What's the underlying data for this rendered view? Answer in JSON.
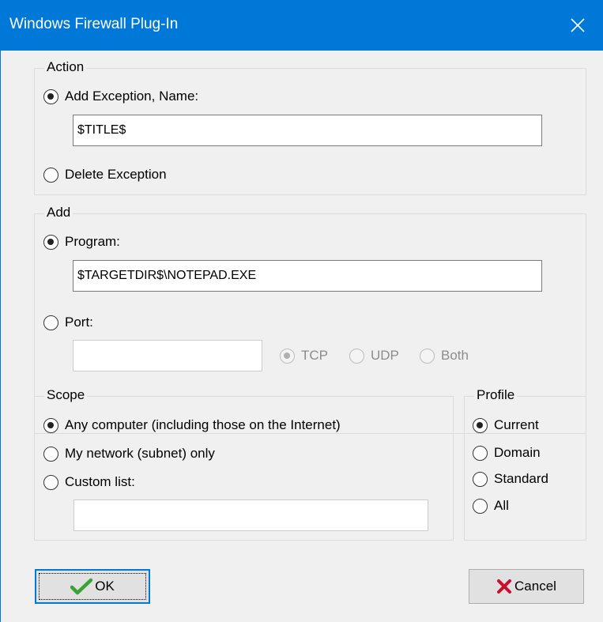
{
  "window": {
    "title": "Windows Firewall Plug-In",
    "close_glyph": "✕"
  },
  "action": {
    "legend": "Action",
    "add_exception_label": "Add Exception, Name:",
    "name_value": "$TITLE$",
    "delete_exception_label": "Delete Exception",
    "selected": "add_exception"
  },
  "add": {
    "legend": "Add",
    "program_label": "Program:",
    "program_value": "$TARGETDIR$\\NOTEPAD.EXE",
    "port_label": "Port:",
    "port_value": "",
    "protocols": [
      "TCP",
      "UDP",
      "Both"
    ],
    "selected_protocol": "TCP",
    "selected": "program"
  },
  "scope": {
    "legend": "Scope",
    "options": [
      "Any computer (including those on the Internet)",
      "My network (subnet) only",
      "Custom list:"
    ],
    "selected": 0,
    "custom_value": ""
  },
  "profile": {
    "legend": "Profile",
    "options": [
      "Current",
      "Domain",
      "Standard",
      "All"
    ],
    "selected": 0
  },
  "buttons": {
    "ok_label": "OK",
    "cancel_label": "Cancel"
  },
  "icons": {
    "ok": "green-checkmark-icon",
    "cancel": "red-x-icon"
  },
  "colors": {
    "titlebar": "#0078d7",
    "ok_icon": "#3aa335",
    "cancel_icon": "#c8102e"
  }
}
